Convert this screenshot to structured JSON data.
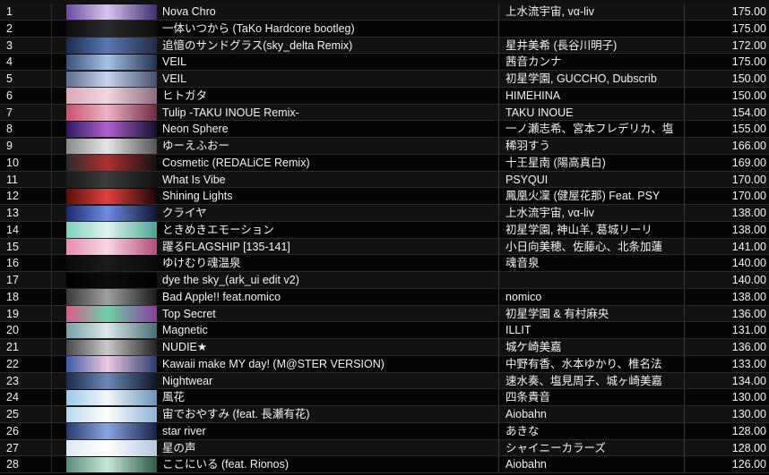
{
  "tracks": [
    {
      "num": "1",
      "title": "Nova Chro",
      "artist": "上水流宇宙, vα-liv",
      "bpm": "175.00",
      "art": [
        "#6b4aa0",
        "#d9c4f0",
        "#3f2d70"
      ]
    },
    {
      "num": "2",
      "title": "一体いつから (TaKo Hardcore bootleg)",
      "artist": "",
      "bpm": "175.00",
      "art": [
        "#0d0d0d",
        "#2a2a2a",
        "#0d0d0d"
      ]
    },
    {
      "num": "3",
      "title": "追憶のサンドグラス(sky_delta Remix)",
      "artist": "星井美希 (長谷川明子)",
      "bpm": "172.00",
      "art": [
        "#1b2b4d",
        "#5a78b0",
        "#222a44"
      ]
    },
    {
      "num": "4",
      "title": "VEIL",
      "artist": "茜音カンナ",
      "bpm": "175.00",
      "art": [
        "#3b4f7a",
        "#a7c2e8",
        "#24324f"
      ]
    },
    {
      "num": "5",
      "title": "VEIL",
      "artist": "初星学園, GUCCHO, Dubscrib",
      "bpm": "150.00",
      "art": [
        "#5d6e90",
        "#c8d4ec",
        "#43516e"
      ]
    },
    {
      "num": "6",
      "title": "ヒトガタ",
      "artist": "HIMEHINA",
      "bpm": "150.00",
      "art": [
        "#d9a9b8",
        "#f2d8e2",
        "#8e6a80"
      ]
    },
    {
      "num": "7",
      "title": "Tulip -TAKU INOUE Remix-",
      "artist": "TAKU INOUE",
      "bpm": "154.00",
      "art": [
        "#c7526e",
        "#f0b3c6",
        "#6e2b43"
      ]
    },
    {
      "num": "8",
      "title": "Neon Sphere",
      "artist": "一ノ瀬志希、宮本フレデリカ、塩",
      "bpm": "155.00",
      "art": [
        "#2a1a5e",
        "#b060d0",
        "#120d30"
      ]
    },
    {
      "num": "9",
      "title": "ゆーえふおー",
      "artist": "稀羽すう",
      "bpm": "166.00",
      "art": [
        "#8a8a8a",
        "#e6e6e6",
        "#555555"
      ]
    },
    {
      "num": "10",
      "title": "Cosmetic (REDALiCE Remix)",
      "artist": "十王星南 (陽高真白)",
      "bpm": "169.00",
      "art": [
        "#2b2b2b",
        "#b03030",
        "#111111"
      ]
    },
    {
      "num": "11",
      "title": "What Is Vibe",
      "artist": "PSYQUI",
      "bpm": "170.00",
      "art": [
        "#1a1a1a",
        "#3c3c3c",
        "#101010"
      ]
    },
    {
      "num": "12",
      "title": "Shining Lights",
      "artist": "鳳凰火凜 (健屋花那) Feat. PSY",
      "bpm": "170.00",
      "art": [
        "#5a0f0f",
        "#e04040",
        "#1c0606"
      ]
    },
    {
      "num": "13",
      "title": "クライヤ",
      "artist": "上水流宇宙, vα-liv",
      "bpm": "138.00",
      "art": [
        "#1c2a6e",
        "#6f8ce0",
        "#0e1636"
      ]
    },
    {
      "num": "14",
      "title": "ときめきエモーション",
      "artist": "初星学園, 神山羊, 葛城リーリ",
      "bpm": "138.00",
      "art": [
        "#7fcfc0",
        "#e0f4ee",
        "#4ba394"
      ]
    },
    {
      "num": "15",
      "title": "躍るFLAGSHIP [135-141]",
      "artist": "小日向美穂、佐藤心、北条加蓮",
      "bpm": "141.00",
      "art": [
        "#e58fb0",
        "#f9d6e4",
        "#b44d7a"
      ]
    },
    {
      "num": "16",
      "title": "ゆけむり魂温泉",
      "artist": "魂音泉",
      "bpm": "140.00",
      "art": [
        "#0a0a0a",
        "#1a1a1a",
        "#0a0a0a"
      ]
    },
    {
      "num": "17",
      "title": "dye the sky_(ark_ui edit v2)",
      "artist": "",
      "bpm": "140.00",
      "art": [
        "#000000",
        "#0c0c0c",
        "#000000"
      ]
    },
    {
      "num": "18",
      "title": "Bad Apple!! feat.nomico",
      "artist": "nomico",
      "bpm": "138.00",
      "art": [
        "#3a3a3a",
        "#a0a0a0",
        "#1a1a1a"
      ]
    },
    {
      "num": "19",
      "title": "Top Secret",
      "artist": "初星学園 & 有村麻央",
      "bpm": "136.00",
      "art": [
        "#d85c8a",
        "#6ed0a8",
        "#8a3e9c"
      ]
    },
    {
      "num": "20",
      "title": "Magnetic",
      "artist": "ILLIT",
      "bpm": "131.00",
      "art": [
        "#7aa0a8",
        "#dce8ea",
        "#4a6c74"
      ]
    },
    {
      "num": "21",
      "title": "NUDIE★",
      "artist": "城ケ崎美嘉",
      "bpm": "136.00",
      "art": [
        "#4a4a4a",
        "#c9c9c9",
        "#222222"
      ]
    },
    {
      "num": "22",
      "title": "Kawaii make MY day! (M@STER VERSION)",
      "artist": "中野有香、水本ゆかり、椎名法",
      "bpm": "133.00",
      "art": [
        "#3c5aa8",
        "#f0c8e0",
        "#2a3b70"
      ]
    },
    {
      "num": "23",
      "title": "Nightwear",
      "artist": "速水奏、塩見周子、城ヶ崎美嘉",
      "bpm": "134.00",
      "art": [
        "#1a2a4a",
        "#6c88b8",
        "#0c1426"
      ]
    },
    {
      "num": "24",
      "title": "風花",
      "artist": "四条貴音",
      "bpm": "130.00",
      "art": [
        "#9ec8e8",
        "#f2f8fc",
        "#6a94b8"
      ]
    },
    {
      "num": "25",
      "title": "宙でおやすみ (feat. 長瀬有花)",
      "artist": "Aiobahn",
      "bpm": "130.00",
      "art": [
        "#b8d8ee",
        "#ffffff",
        "#8ab4d4"
      ]
    },
    {
      "num": "26",
      "title": "star river",
      "artist": "あきな",
      "bpm": "128.00",
      "art": [
        "#2a3a6e",
        "#8aa4e0",
        "#18224a"
      ]
    },
    {
      "num": "27",
      "title": "星の声",
      "artist": "シャイニーカラーズ",
      "bpm": "128.00",
      "art": [
        "#dfe8f4",
        "#ffffff",
        "#b6c8e0"
      ]
    },
    {
      "num": "28",
      "title": "ここにいる (feat. Rionos)",
      "artist": "Aiobahn",
      "bpm": "126.00",
      "art": [
        "#5a8e7a",
        "#c8e6d8",
        "#2e5a48"
      ]
    }
  ]
}
